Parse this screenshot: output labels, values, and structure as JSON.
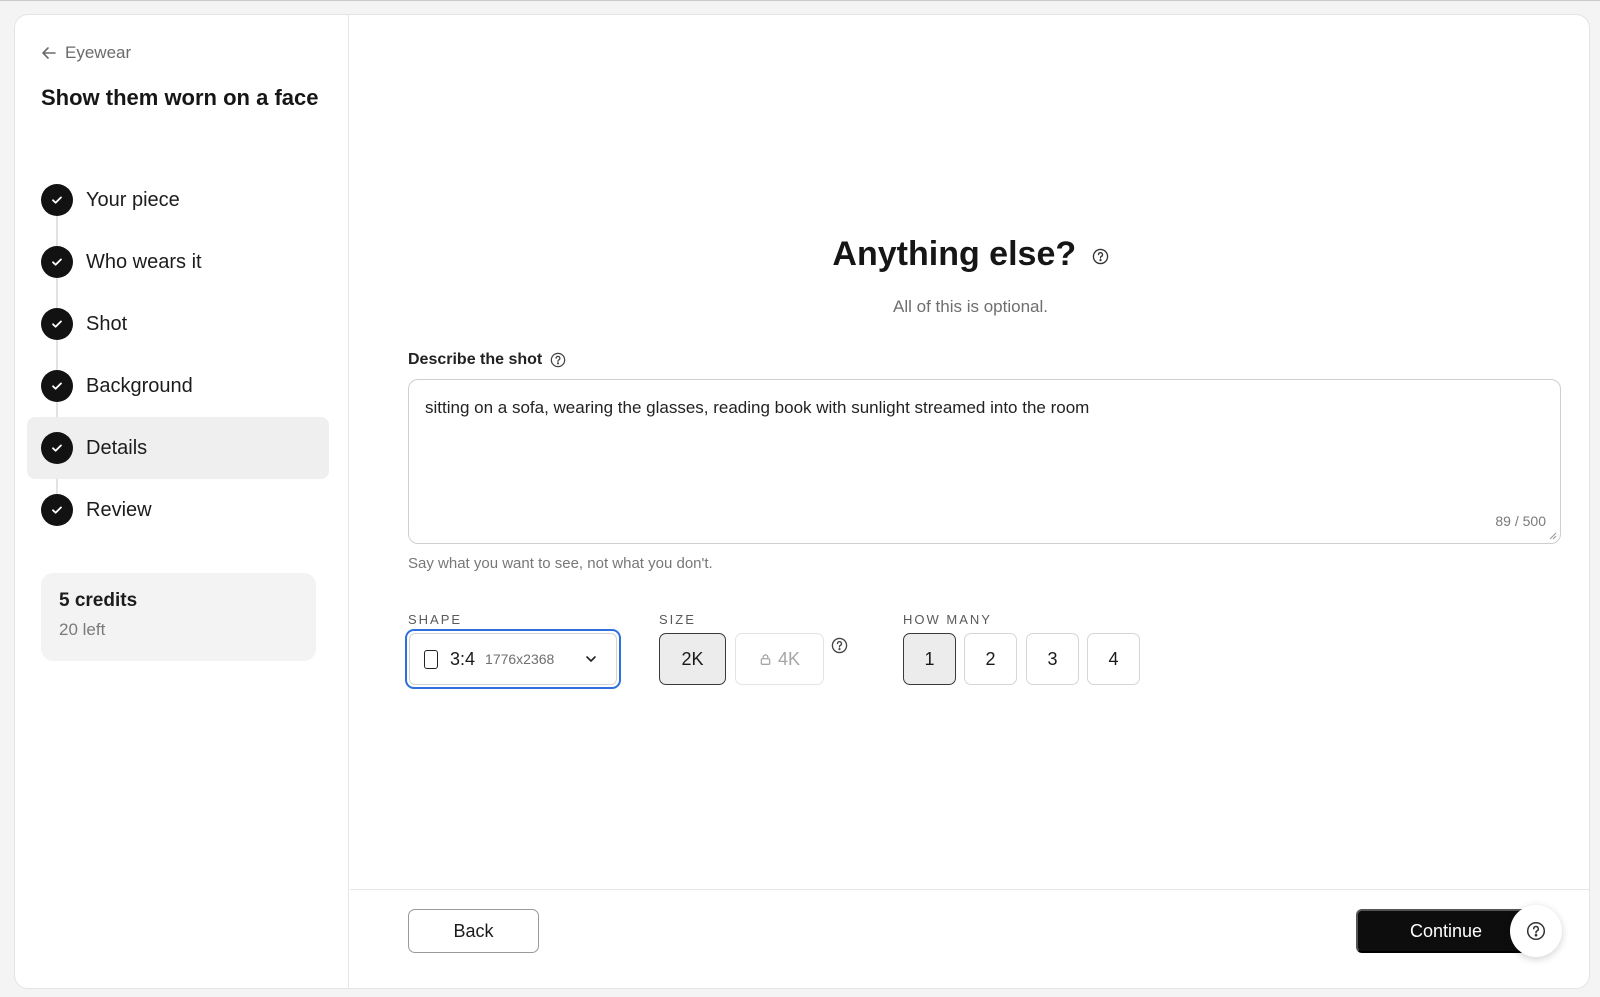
{
  "sidebar": {
    "back_label": "Eyewear",
    "title": "Show them worn on a face",
    "steps": [
      {
        "label": "Your piece",
        "done": true
      },
      {
        "label": "Who wears it",
        "done": true
      },
      {
        "label": "Shot",
        "done": true
      },
      {
        "label": "Background",
        "done": true
      },
      {
        "label": "Details",
        "done": true,
        "active": true
      },
      {
        "label": "Review",
        "done": true
      }
    ],
    "credits": {
      "amount": "5 credits",
      "remaining": "20 left"
    }
  },
  "main": {
    "heading": "Anything else?",
    "subheading": "All of this is optional.",
    "describe": {
      "label": "Describe the shot",
      "value": "sitting on a sofa, wearing the glasses, reading book with sunlight streamed into the room",
      "count": "89 / 500",
      "hint": "Say what you want to see, not what you don't."
    },
    "shape": {
      "label": "SHAPE",
      "selected_ratio": "3:4",
      "selected_dims": "1776x2368"
    },
    "size": {
      "label": "SIZE",
      "options": [
        "2K",
        "4K"
      ],
      "selected": "2K",
      "locked": "4K"
    },
    "how_many": {
      "label": "HOW MANY",
      "options": [
        "1",
        "2",
        "3",
        "4"
      ],
      "selected": "1"
    }
  },
  "footer": {
    "back_label": "Back",
    "continue_label": "Continue"
  },
  "colors": {
    "accent_focus": "#2f6fde",
    "primary_button": "#0d0d0d"
  }
}
